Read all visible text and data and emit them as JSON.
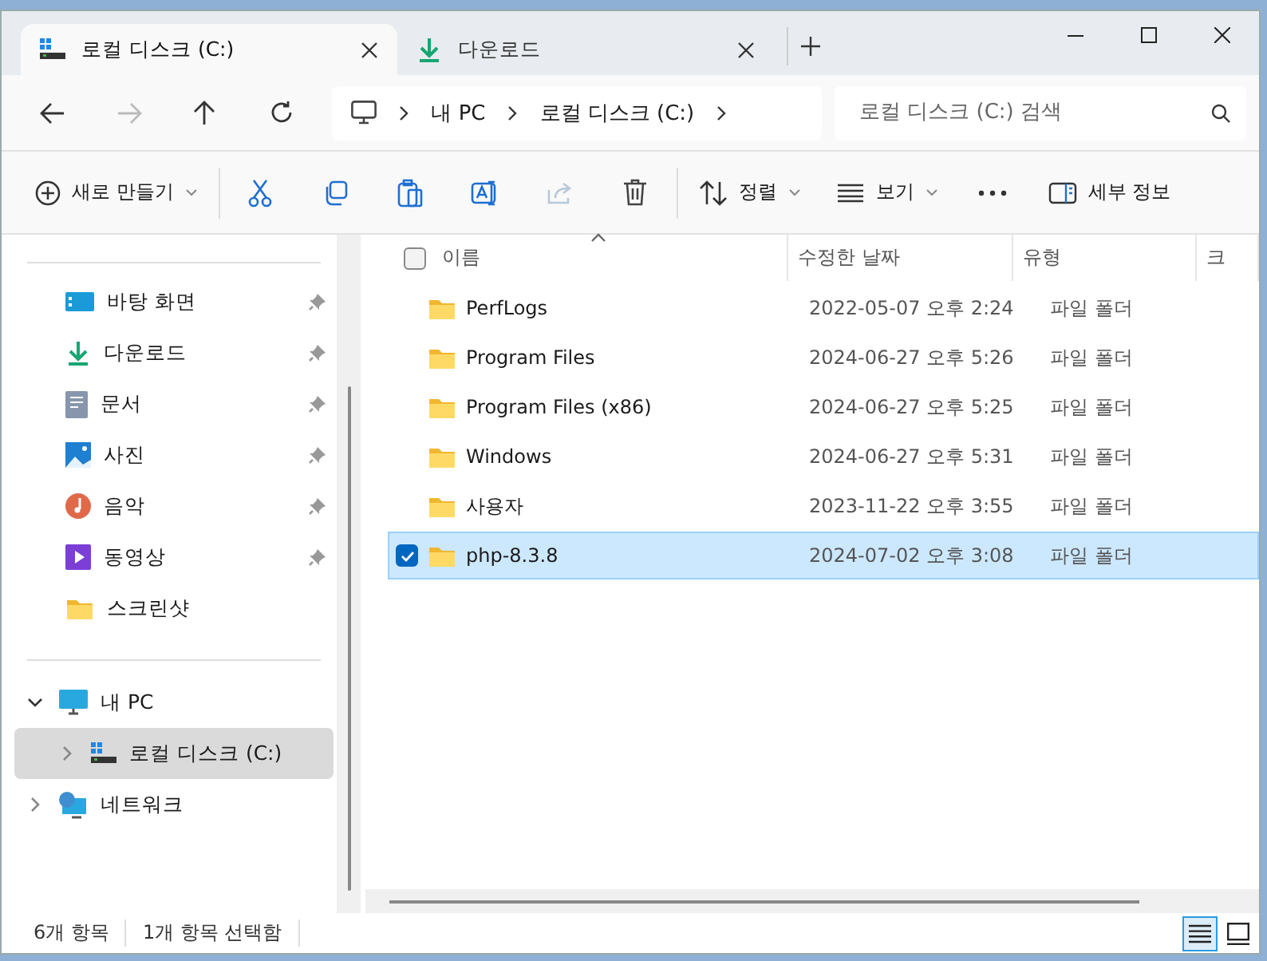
{
  "tabs": [
    {
      "label": "로컬 디스크 (C:)",
      "kind": "drive",
      "selected": true
    },
    {
      "label": "다운로드",
      "kind": "download",
      "selected": false
    }
  ],
  "nav": [
    {
      "kind": "back",
      "disabled": false
    },
    {
      "kind": "forward",
      "disabled": true
    },
    {
      "kind": "up",
      "disabled": false
    },
    {
      "kind": "refresh",
      "disabled": false
    }
  ],
  "breadcrumb": [
    "내 PC",
    "로컬 디스크 (C:)"
  ],
  "search": {
    "placeholder": "로컬 디스크 (C:) 검색"
  },
  "toolbar": [
    {
      "kind": "new",
      "label": "새로 만들기",
      "disabled": false
    },
    {
      "kind": "cut",
      "disabled": false
    },
    {
      "kind": "copy",
      "disabled": false
    },
    {
      "kind": "paste",
      "disabled": false
    },
    {
      "kind": "rename",
      "disabled": false
    },
    {
      "kind": "share",
      "disabled": true
    },
    {
      "kind": "delete",
      "disabled": false
    },
    {
      "kind": "sort",
      "label": "정렬",
      "disabled": false
    },
    {
      "kind": "view",
      "label": "보기",
      "disabled": false
    },
    {
      "kind": "more",
      "disabled": false
    },
    {
      "kind": "details",
      "label": "세부 정보",
      "disabled": false
    }
  ],
  "quick_access": [
    {
      "label": "바탕 화면",
      "kind": "desktop",
      "pinned": true
    },
    {
      "label": "다운로드",
      "kind": "download",
      "pinned": true
    },
    {
      "label": "문서",
      "kind": "document",
      "pinned": true
    },
    {
      "label": "사진",
      "kind": "pictures",
      "pinned": true
    },
    {
      "label": "음악",
      "kind": "music",
      "pinned": true
    },
    {
      "label": "동영상",
      "kind": "video",
      "pinned": true
    },
    {
      "label": "스크린샷",
      "kind": "folder",
      "pinned": false
    }
  ],
  "tree": [
    {
      "label": "내 PC",
      "kind": "pc",
      "expanded": true,
      "selected": false,
      "children": [
        {
          "label": "로컬 디스크 (C:)",
          "kind": "drive",
          "expanded": false,
          "selected": true
        }
      ]
    },
    {
      "label": "네트워크",
      "kind": "network",
      "expanded": false,
      "selected": false
    }
  ],
  "select_all": {
    "checked": false
  },
  "columns": [
    "이름",
    "수정한 날짜",
    "유형",
    "크"
  ],
  "rows": [
    {
      "name": "PerfLogs",
      "date": "2022-05-07 오후 2:24",
      "type": "파일 폴더",
      "selected": false
    },
    {
      "name": "Program Files",
      "date": "2024-06-27 오후 5:26",
      "type": "파일 폴더",
      "selected": false
    },
    {
      "name": "Program Files (x86)",
      "date": "2024-06-27 오후 5:25",
      "type": "파일 폴더",
      "selected": false
    },
    {
      "name": "Windows",
      "date": "2024-06-27 오후 5:31",
      "type": "파일 폴더",
      "selected": false
    },
    {
      "name": "사용자",
      "date": "2023-11-22 오후 3:55",
      "type": "파일 폴더",
      "selected": false
    },
    {
      "name": "php-8.3.8",
      "date": "2024-07-02 오후 3:08",
      "type": "파일 폴더",
      "selected": true
    }
  ],
  "status_bar": [
    "6개 항목",
    "1개 항목 선택함"
  ],
  "view_modes": [
    {
      "kind": "details",
      "selected": true
    },
    {
      "kind": "tiles",
      "selected": false
    }
  ]
}
